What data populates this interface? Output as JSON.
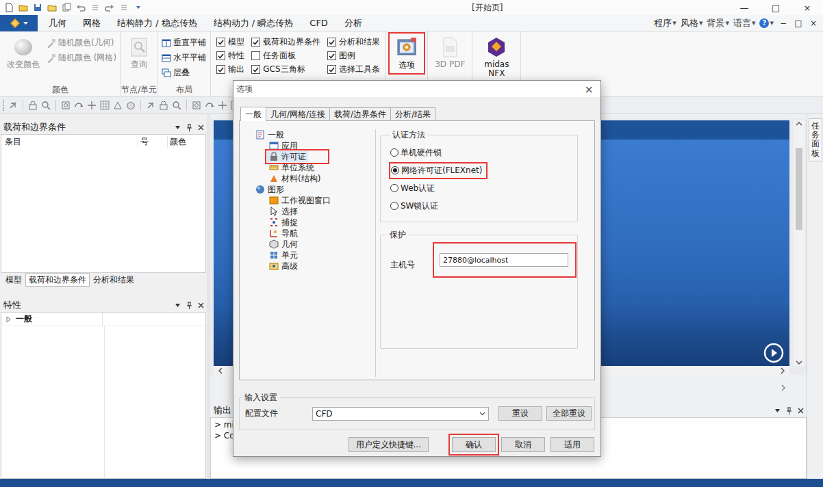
{
  "window": {
    "title": "[开始页]",
    "controls": [
      "—",
      "□",
      "×"
    ]
  },
  "menu_bar": {
    "tabs": [
      "几何",
      "网格",
      "结构静力 / 稳态传热",
      "结构动力 / 瞬态传热",
      "CFD",
      "分析"
    ],
    "right_menus": [
      "程序",
      "风格",
      "背景",
      "语言"
    ],
    "dropdown_glyph": "▾",
    "help": "?",
    "mdi_controls": [
      "−",
      "□",
      "×"
    ]
  },
  "ribbon": {
    "groups": [
      {
        "label": "颜色",
        "items": [
          {
            "label": "改变颜色",
            "kind": "large",
            "disabled": true,
            "annotated": false
          },
          {
            "label": "随机颜色(几何)",
            "kind": "small",
            "disabled": true
          },
          {
            "label": "随机颜色 (网格)",
            "kind": "small",
            "disabled": true
          }
        ]
      },
      {
        "label": "节点/单元",
        "items": [
          {
            "label": "查询",
            "kind": "large",
            "disabled": true,
            "annotated": false
          }
        ]
      },
      {
        "label": "布局",
        "items": [
          {
            "label": "垂直平铺",
            "kind": "small",
            "disabled": false
          },
          {
            "label": "水平平铺",
            "kind": "small",
            "disabled": false
          },
          {
            "label": "层叠",
            "kind": "small",
            "disabled": false
          }
        ]
      },
      {
        "items": [
          {
            "label": "模型",
            "kind": "check",
            "checked": true
          },
          {
            "label": "特性",
            "kind": "check",
            "checked": true
          },
          {
            "label": "输出",
            "kind": "check",
            "checked": true
          },
          {
            "label": "载荷和边界条件",
            "kind": "check",
            "checked": true
          },
          {
            "label": "任务面板",
            "kind": "check",
            "checked": false
          },
          {
            "label": "GCS三角标",
            "kind": "check",
            "checked": true
          },
          {
            "label": "分析和结果",
            "kind": "check",
            "checked": true
          },
          {
            "label": "图例",
            "kind": "check",
            "checked": true
          },
          {
            "label": "选择工具条",
            "kind": "check",
            "checked": true
          }
        ]
      },
      {
        "items": [
          {
            "label": "选项",
            "kind": "large",
            "disabled": false,
            "annotated": true
          }
        ]
      },
      {
        "items": [
          {
            "label": "3D PDF",
            "kind": "large",
            "disabled": true,
            "annotated": false
          }
        ]
      },
      {
        "items": [
          {
            "label": "midas NFX",
            "kind": "large",
            "disabled": false,
            "annotated": false
          }
        ]
      }
    ]
  },
  "left_panel": {
    "title": "载荷和边界条件",
    "columns": [
      "条目",
      "号",
      "颜色"
    ],
    "tabs": [
      {
        "label": "模型",
        "selected": false
      },
      {
        "label": "载荷和边界条件",
        "selected": true
      },
      {
        "label": "分析和结果",
        "selected": false
      }
    ]
  },
  "properties_panel": {
    "title": "特性",
    "rows": [
      {
        "label": "一般",
        "expanded": false
      }
    ]
  },
  "task_panel_tab": "任务面板",
  "output_panel": {
    "title": "输出",
    "lines": [
      "> mid",
      "> Cop"
    ]
  },
  "dialog": {
    "title": "选项",
    "close": "×",
    "tabs": [
      {
        "label": "一般",
        "selected": true
      },
      {
        "label": "几何/网格/连接",
        "selected": false
      },
      {
        "label": "载荷/边界条件",
        "selected": false
      },
      {
        "label": "分析/结果",
        "selected": false
      }
    ],
    "tree": [
      {
        "label": "一般",
        "expanded": true,
        "children": [
          {
            "label": "应用",
            "selected": false,
            "annotated": false
          },
          {
            "label": "许可证",
            "selected": true,
            "annotated": true
          },
          {
            "label": "单位系统",
            "selected": false,
            "annotated": false
          },
          {
            "label": "材料(结构)",
            "selected": false,
            "annotated": false
          }
        ]
      },
      {
        "label": "图形",
        "expanded": true,
        "children": [
          {
            "label": "工作视图窗口",
            "selected": false,
            "annotated": false
          },
          {
            "label": "选择",
            "selected": false,
            "annotated": false
          },
          {
            "label": "捕捉",
            "selected": false,
            "annotated": false
          },
          {
            "label": "导航",
            "selected": false,
            "annotated": false
          },
          {
            "label": "几何",
            "selected": false,
            "annotated": false
          },
          {
            "label": "单元",
            "selected": false,
            "annotated": false
          },
          {
            "label": "高级",
            "selected": false,
            "annotated": false
          }
        ]
      }
    ],
    "auth": {
      "title": "认证方法",
      "options": [
        {
          "label": "单机硬件锁",
          "selected": false,
          "annotated": false
        },
        {
          "label": "网络许可证(FLEXnet)",
          "selected": true,
          "annotated": true
        },
        {
          "label": "Web认证",
          "selected": false,
          "annotated": false
        },
        {
          "label": "SW锁认证",
          "selected": false,
          "annotated": false
        }
      ]
    },
    "protection": {
      "title": "保护",
      "field_label": "主机号",
      "value": "27880@localhost",
      "annotated": true
    },
    "input_settings": {
      "title": "输入设置",
      "field_label": "配置文件",
      "value": "CFD",
      "buttons": [
        "重设",
        "全部重设"
      ]
    },
    "buttons": [
      {
        "label": "用户定义快捷键...",
        "annotated": false
      },
      {
        "label": "确认",
        "annotated": true
      },
      {
        "label": "取消",
        "annotated": false
      },
      {
        "label": "适用",
        "annotated": false
      }
    ]
  }
}
